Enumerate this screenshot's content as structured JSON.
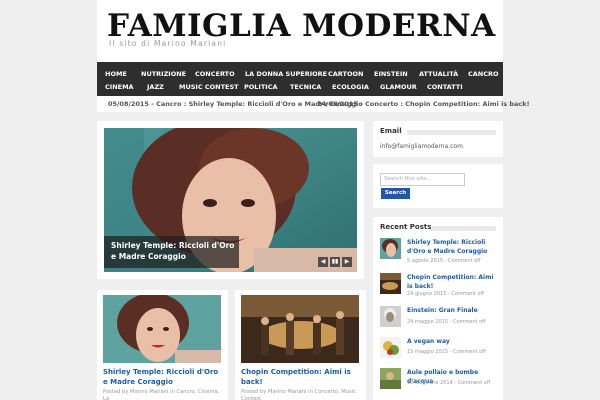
{
  "site": {
    "title": "FAMIGLIA MODERNA",
    "tagline": "Il sito di Marino Mariani"
  },
  "nav": {
    "row1": [
      "HOME",
      "NUTRIZIONE",
      "CONCERTO",
      "LA DONNA SUPERIORE",
      "CARTOON",
      "EINSTEIN",
      "ATTUALITÀ",
      "CANCRO"
    ],
    "row2": [
      "CINEMA",
      "JAZZ",
      "MUSIC CONTEST",
      "POLITICA",
      "TECNICA",
      "ECOLOGIA",
      "GLAMOUR",
      "CONTATTI"
    ]
  },
  "ticker": {
    "item1": "05/08/2015 - Cancro : Shirley Temple: Riccioli d'Oro e Madre Coraggio",
    "item2": "24/06/2015 - Concerto : Chopin Competition: Aimi is back!"
  },
  "slider": {
    "caption": "Shirley Temple: Riccioli d'Oro e Madre Coraggio",
    "controls": [
      "◀",
      "▮▮",
      "▶"
    ]
  },
  "cards": [
    {
      "title": "Shirley Temple: Riccioli d'Oro e Madre Coraggio",
      "meta": "Posted by Marino Mariani in Cancro, Cinema, La"
    },
    {
      "title": "Chopin Competition: Aimi is back!",
      "meta": "Posted by Marino Mariani in Concerto, Music Contest"
    }
  ],
  "sidebar": {
    "email": {
      "title": "Email",
      "address": "info@famigliamoderna.com"
    },
    "search": {
      "placeholder": "Search this site...",
      "button": "Search"
    },
    "recent": {
      "title": "Recent Posts",
      "posts": [
        {
          "title": "Shirley Temple: Riccioli d'Oro e Madre Coraggio",
          "date": "5 agosto 2015 - Comment off"
        },
        {
          "title": "Chopin Competition: Aimi is back!",
          "date": "24 giugno 2015 - Comment off"
        },
        {
          "title": "Einstein: Gran Finale",
          "date": "24 maggio 2015 - Comment off"
        },
        {
          "title": "A vegan way",
          "date": "15 maggio 2015 - Comment off"
        },
        {
          "title": "Aule pollaio e bombe d'acqua",
          "date": "13 dicembre 2014 - Comment off"
        }
      ]
    }
  },
  "colors": {
    "nav_bg": "#2e2e2e",
    "link": "#1b5da8",
    "button": "#2157a8",
    "page_bg": "#efefef"
  }
}
